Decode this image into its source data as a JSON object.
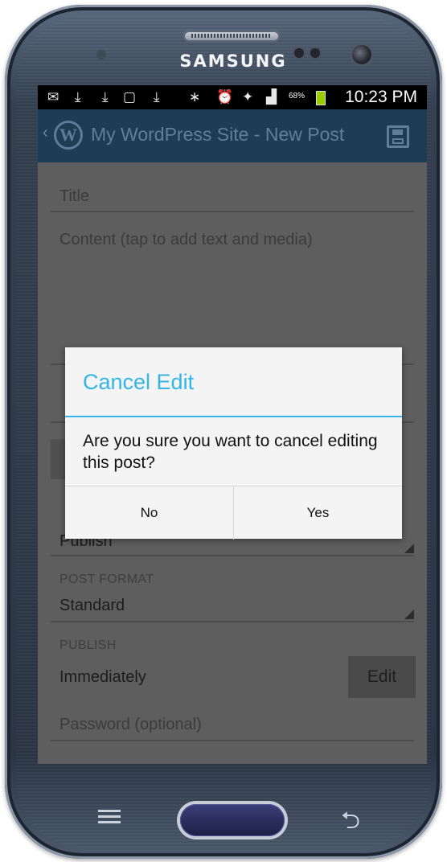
{
  "device": {
    "brand": "SAMSUNG"
  },
  "status_bar": {
    "battery_percent": "68%",
    "time": "10:23 PM",
    "icons": [
      "notification-icon",
      "download-icon",
      "download-icon",
      "file-download-icon",
      "download-icon",
      "bluetooth-icon",
      "alarm-icon",
      "wifi-icon",
      "signal-icon",
      "battery-icon"
    ]
  },
  "action_bar": {
    "title": "My WordPress Site - New Post",
    "logo": "W"
  },
  "form": {
    "title_placeholder": "Title",
    "content_placeholder": "Content (tap to add text and media)",
    "status_value": "Publish",
    "post_format_label": "POST FORMAT",
    "post_format_value": "Standard",
    "publish_label": "PUBLISH",
    "publish_value": "Immediately",
    "edit_button": "Edit",
    "password_placeholder": "Password (optional)"
  },
  "dialog": {
    "title": "Cancel Edit",
    "message": "Are you sure you want to cancel editing this post?",
    "no_label": "No",
    "yes_label": "Yes",
    "accent_color": "#33b5e5"
  },
  "nav_buttons": {
    "back_glyph": "⮌"
  }
}
